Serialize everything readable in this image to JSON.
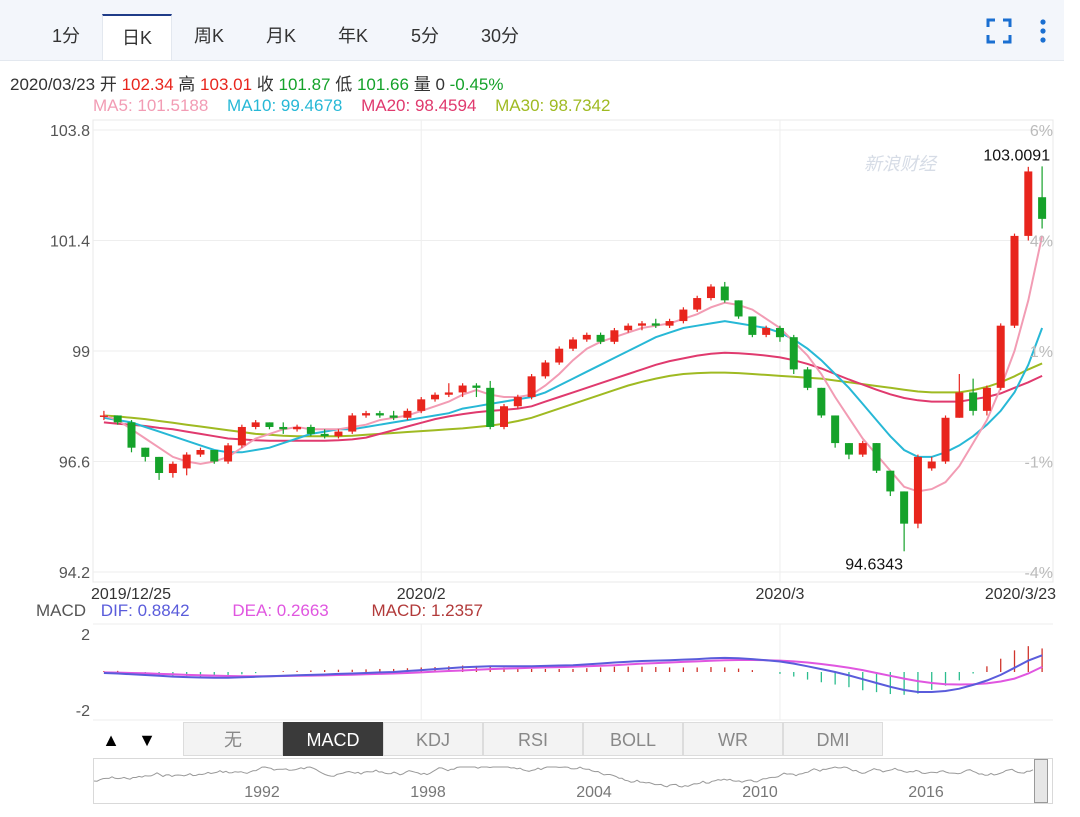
{
  "tabs": [
    "1分",
    "日K",
    "周K",
    "月K",
    "年K",
    "5分",
    "30分"
  ],
  "active_tab": "日K",
  "icons": {
    "fullscreen": "fullscreen-icon",
    "more": "more-vertical-icon"
  },
  "info": {
    "date": "2020/03/23",
    "open_label": "开",
    "open": "102.34",
    "high_label": "高",
    "high": "103.01",
    "close_label": "收",
    "close": "101.87",
    "low_label": "低",
    "low": "101.66",
    "vol_label": "量",
    "vol": "0",
    "change": "-0.45%"
  },
  "ma": {
    "ma5": "MA5: 101.5188",
    "ma10": "MA10: 99.4678",
    "ma20": "MA20: 98.4594",
    "ma30": "MA30: 98.7342"
  },
  "colors": {
    "up": "#e8251d",
    "down": "#15a22a",
    "ma5": "#f29cb4",
    "ma10": "#27b8d6",
    "ma20": "#e03a6e",
    "ma30": "#9fba22",
    "dif": "#5a5cdb",
    "dea": "#e056e0",
    "macd": "#b23a3a",
    "info_red": "#e8251d",
    "info_green": "#15a22a"
  },
  "watermark": "新浪财经",
  "chart_data": {
    "type": "candlestick",
    "ylim": [
      94.2,
      103.8
    ],
    "yticks": [
      "103.8",
      "101.4",
      "99",
      "96.6",
      "94.2"
    ],
    "right_ticks": [
      "6%",
      "4%",
      "1%",
      "-1%",
      "-4%"
    ],
    "xticks": [
      "2019/12/25",
      "2020/2",
      "2020/3",
      "2020/3/23"
    ],
    "max_label": "103.0091",
    "min_label": "94.6343",
    "candles": [
      [
        97.6,
        97.7,
        97.5,
        97.6
      ],
      [
        97.6,
        97.6,
        97.4,
        97.45
      ],
      [
        97.45,
        97.5,
        96.8,
        96.9
      ],
      [
        96.9,
        96.9,
        96.6,
        96.7
      ],
      [
        96.7,
        96.7,
        96.2,
        96.35
      ],
      [
        96.35,
        96.6,
        96.25,
        96.55
      ],
      [
        96.45,
        96.8,
        96.3,
        96.75
      ],
      [
        96.75,
        96.9,
        96.7,
        96.85
      ],
      [
        96.85,
        96.85,
        96.55,
        96.6
      ],
      [
        96.6,
        97.0,
        96.55,
        96.95
      ],
      [
        96.95,
        97.4,
        96.9,
        97.35
      ],
      [
        97.35,
        97.5,
        97.3,
        97.45
      ],
      [
        97.45,
        97.45,
        97.3,
        97.35
      ],
      [
        97.35,
        97.45,
        97.2,
        97.3
      ],
      [
        97.3,
        97.4,
        97.25,
        97.35
      ],
      [
        97.35,
        97.4,
        97.15,
        97.2
      ],
      [
        97.2,
        97.3,
        97.1,
        97.15
      ],
      [
        97.15,
        97.3,
        97.1,
        97.25
      ],
      [
        97.25,
        97.65,
        97.2,
        97.6
      ],
      [
        97.6,
        97.7,
        97.55,
        97.65
      ],
      [
        97.65,
        97.7,
        97.55,
        97.6
      ],
      [
        97.6,
        97.7,
        97.5,
        97.55
      ],
      [
        97.55,
        97.75,
        97.5,
        97.7
      ],
      [
        97.7,
        98.0,
        97.65,
        97.95
      ],
      [
        97.95,
        98.1,
        97.9,
        98.05
      ],
      [
        98.05,
        98.3,
        98.0,
        98.1
      ],
      [
        98.1,
        98.3,
        98.0,
        98.25
      ],
      [
        98.25,
        98.3,
        98.0,
        98.2
      ],
      [
        98.2,
        98.35,
        97.3,
        97.35
      ],
      [
        97.35,
        97.85,
        97.3,
        97.8
      ],
      [
        97.8,
        98.05,
        97.75,
        98.0
      ],
      [
        98.0,
        98.5,
        97.95,
        98.45
      ],
      [
        98.45,
        98.8,
        98.4,
        98.75
      ],
      [
        98.75,
        99.1,
        98.7,
        99.05
      ],
      [
        99.05,
        99.3,
        99.0,
        99.25
      ],
      [
        99.25,
        99.4,
        99.2,
        99.35
      ],
      [
        99.35,
        99.4,
        99.15,
        99.2
      ],
      [
        99.2,
        99.5,
        99.15,
        99.45
      ],
      [
        99.45,
        99.6,
        99.4,
        99.55
      ],
      [
        99.55,
        99.65,
        99.45,
        99.6
      ],
      [
        99.6,
        99.7,
        99.5,
        99.55
      ],
      [
        99.55,
        99.7,
        99.5,
        99.65
      ],
      [
        99.65,
        99.95,
        99.6,
        99.9
      ],
      [
        99.9,
        100.2,
        99.85,
        100.15
      ],
      [
        100.15,
        100.45,
        100.1,
        100.4
      ],
      [
        100.4,
        100.5,
        100.05,
        100.1
      ],
      [
        100.1,
        100.1,
        99.7,
        99.75
      ],
      [
        99.75,
        99.75,
        99.3,
        99.35
      ],
      [
        99.35,
        99.55,
        99.3,
        99.5
      ],
      [
        99.5,
        99.55,
        99.2,
        99.3
      ],
      [
        99.3,
        99.35,
        98.5,
        98.6
      ],
      [
        98.6,
        98.65,
        98.15,
        98.2
      ],
      [
        98.2,
        98.2,
        97.55,
        97.6
      ],
      [
        97.6,
        97.6,
        96.9,
        97.0
      ],
      [
        97.0,
        97.0,
        96.65,
        96.75
      ],
      [
        96.75,
        97.05,
        96.7,
        97.0
      ],
      [
        97.0,
        97.0,
        96.35,
        96.4
      ],
      [
        96.4,
        96.4,
        95.85,
        95.95
      ],
      [
        95.95,
        95.95,
        94.65,
        95.25
      ],
      [
        95.25,
        96.75,
        95.15,
        96.7
      ],
      [
        96.45,
        96.7,
        96.4,
        96.6
      ],
      [
        96.6,
        97.6,
        96.55,
        97.55
      ],
      [
        97.55,
        98.5,
        97.55,
        98.1
      ],
      [
        98.1,
        98.4,
        97.6,
        97.7
      ],
      [
        97.7,
        98.25,
        97.6,
        98.2
      ],
      [
        98.2,
        99.6,
        98.15,
        99.55
      ],
      [
        99.55,
        101.55,
        99.5,
        101.5
      ],
      [
        101.5,
        103.0,
        101.4,
        102.9
      ],
      [
        102.34,
        103.01,
        101.66,
        101.87
      ]
    ],
    "ma5": [
      97.6,
      97.5,
      97.3,
      97.1,
      96.9,
      96.7,
      96.6,
      96.55,
      96.6,
      96.7,
      96.9,
      97.1,
      97.2,
      97.3,
      97.35,
      97.3,
      97.3,
      97.3,
      97.35,
      97.4,
      97.5,
      97.55,
      97.6,
      97.7,
      97.8,
      97.9,
      98.05,
      98.15,
      98.05,
      98.0,
      98.0,
      98.05,
      98.25,
      98.5,
      98.8,
      99.05,
      99.2,
      99.3,
      99.4,
      99.5,
      99.55,
      99.6,
      99.7,
      99.8,
      99.95,
      100.05,
      100.0,
      99.9,
      99.7,
      99.5,
      99.2,
      98.9,
      98.5,
      98.0,
      97.55,
      97.1,
      96.75,
      96.4,
      96.05,
      95.95,
      96.0,
      96.15,
      96.5,
      97.0,
      97.5,
      98.2,
      99.0,
      100.1,
      101.5
    ],
    "ma10": [
      97.55,
      97.5,
      97.45,
      97.35,
      97.25,
      97.15,
      97.05,
      96.95,
      96.85,
      96.8,
      96.8,
      96.85,
      96.9,
      97.0,
      97.1,
      97.2,
      97.25,
      97.3,
      97.3,
      97.35,
      97.4,
      97.45,
      97.5,
      97.55,
      97.6,
      97.65,
      97.75,
      97.8,
      97.85,
      97.9,
      97.95,
      98.0,
      98.1,
      98.25,
      98.4,
      98.55,
      98.7,
      98.85,
      99.0,
      99.15,
      99.3,
      99.4,
      99.5,
      99.55,
      99.6,
      99.65,
      99.6,
      99.55,
      99.5,
      99.4,
      99.25,
      99.05,
      98.8,
      98.5,
      98.2,
      97.85,
      97.5,
      97.15,
      96.85,
      96.7,
      96.7,
      96.8,
      96.95,
      97.15,
      97.4,
      97.7,
      98.1,
      98.7,
      99.5
    ],
    "ma20": [
      97.45,
      97.42,
      97.4,
      97.37,
      97.33,
      97.3,
      97.25,
      97.2,
      97.15,
      97.1,
      97.08,
      97.06,
      97.05,
      97.05,
      97.05,
      97.05,
      97.05,
      97.06,
      97.08,
      97.12,
      97.2,
      97.28,
      97.36,
      97.44,
      97.52,
      97.58,
      97.63,
      97.67,
      97.7,
      97.72,
      97.75,
      97.8,
      97.9,
      98.0,
      98.1,
      98.2,
      98.3,
      98.4,
      98.5,
      98.6,
      98.7,
      98.78,
      98.84,
      98.9,
      98.94,
      98.96,
      98.95,
      98.93,
      98.9,
      98.86,
      98.8,
      98.72,
      98.62,
      98.5,
      98.38,
      98.27,
      98.16,
      98.06,
      97.98,
      97.93,
      97.9,
      97.9,
      97.9,
      97.95,
      98.0,
      98.08,
      98.2,
      98.32,
      98.46
    ],
    "ma30": [
      97.6,
      97.58,
      97.55,
      97.52,
      97.48,
      97.44,
      97.4,
      97.36,
      97.32,
      97.28,
      97.24,
      97.2,
      97.18,
      97.16,
      97.15,
      97.15,
      97.15,
      97.15,
      97.16,
      97.18,
      97.2,
      97.22,
      97.24,
      97.26,
      97.28,
      97.3,
      97.32,
      97.35,
      97.38,
      97.42,
      97.48,
      97.55,
      97.65,
      97.75,
      97.85,
      97.95,
      98.05,
      98.15,
      98.25,
      98.33,
      98.4,
      98.46,
      98.5,
      98.52,
      98.53,
      98.53,
      98.52,
      98.5,
      98.48,
      98.46,
      98.44,
      98.42,
      98.4,
      98.36,
      98.32,
      98.28,
      98.24,
      98.2,
      98.16,
      98.12,
      98.1,
      98.1,
      98.1,
      98.15,
      98.22,
      98.32,
      98.45,
      98.6,
      98.73
    ],
    "macd_ylim": [
      -2,
      2
    ],
    "macd_yticks": [
      "2",
      "-2"
    ],
    "dif": [
      -0.05,
      -0.08,
      -0.12,
      -0.16,
      -0.2,
      -0.24,
      -0.27,
      -0.29,
      -0.3,
      -0.3,
      -0.28,
      -0.25,
      -0.22,
      -0.2,
      -0.17,
      -0.15,
      -0.13,
      -0.1,
      -0.08,
      -0.05,
      -0.02,
      0.0,
      0.05,
      0.1,
      0.15,
      0.2,
      0.25,
      0.28,
      0.3,
      0.3,
      0.3,
      0.3,
      0.32,
      0.34,
      0.36,
      0.4,
      0.45,
      0.5,
      0.54,
      0.58,
      0.6,
      0.62,
      0.65,
      0.68,
      0.72,
      0.74,
      0.72,
      0.68,
      0.62,
      0.55,
      0.44,
      0.3,
      0.15,
      0.0,
      -0.18,
      -0.38,
      -0.58,
      -0.78,
      -0.95,
      -1.05,
      -1.05,
      -1.0,
      -0.88,
      -0.68,
      -0.45,
      -0.15,
      0.22,
      0.6,
      0.88
    ],
    "dea": [
      -0.02,
      -0.03,
      -0.05,
      -0.07,
      -0.1,
      -0.12,
      -0.15,
      -0.17,
      -0.19,
      -0.21,
      -0.22,
      -0.22,
      -0.22,
      -0.21,
      -0.2,
      -0.19,
      -0.18,
      -0.16,
      -0.14,
      -0.12,
      -0.1,
      -0.08,
      -0.05,
      -0.02,
      0.02,
      0.05,
      0.08,
      0.12,
      0.15,
      0.18,
      0.2,
      0.22,
      0.24,
      0.26,
      0.28,
      0.3,
      0.33,
      0.36,
      0.4,
      0.44,
      0.47,
      0.5,
      0.53,
      0.56,
      0.59,
      0.62,
      0.63,
      0.63,
      0.62,
      0.6,
      0.56,
      0.5,
      0.42,
      0.33,
      0.22,
      0.1,
      -0.05,
      -0.2,
      -0.35,
      -0.48,
      -0.58,
      -0.64,
      -0.66,
      -0.64,
      -0.6,
      -0.5,
      -0.35,
      -0.08,
      0.27
    ],
    "macd_hist": [
      0.05,
      0.06,
      -0.1,
      -0.12,
      -0.16,
      -0.2,
      -0.22,
      -0.24,
      -0.22,
      -0.18,
      -0.12,
      -0.06,
      0.0,
      0.04,
      0.06,
      0.08,
      0.1,
      0.12,
      0.12,
      0.14,
      0.16,
      0.16,
      0.2,
      0.24,
      0.26,
      0.3,
      0.34,
      0.32,
      0.3,
      0.24,
      0.2,
      0.16,
      0.16,
      0.16,
      0.16,
      0.2,
      0.24,
      0.28,
      0.28,
      0.28,
      0.26,
      0.24,
      0.24,
      0.24,
      0.26,
      0.24,
      0.18,
      0.1,
      0.0,
      -0.1,
      -0.24,
      -0.4,
      -0.54,
      -0.66,
      -0.8,
      -0.96,
      -1.06,
      -1.16,
      -1.2,
      -1.14,
      -0.94,
      -0.72,
      -0.44,
      -0.08,
      0.3,
      0.7,
      1.14,
      1.36,
      1.24
    ]
  },
  "macd_legend": {
    "title": "MACD",
    "dif": "DIF: 0.8842",
    "dea": "DEA: 0.2663",
    "macd": "MACD: 1.2357"
  },
  "indicator_tabs": [
    "无",
    "MACD",
    "KDJ",
    "RSI",
    "BOLL",
    "WR",
    "DMI"
  ],
  "active_indicator": "MACD",
  "arrows": {
    "up": "▲",
    "down": "▼"
  },
  "navigator": {
    "years": [
      "1992",
      "1998",
      "2004",
      "2010",
      "2016"
    ]
  }
}
